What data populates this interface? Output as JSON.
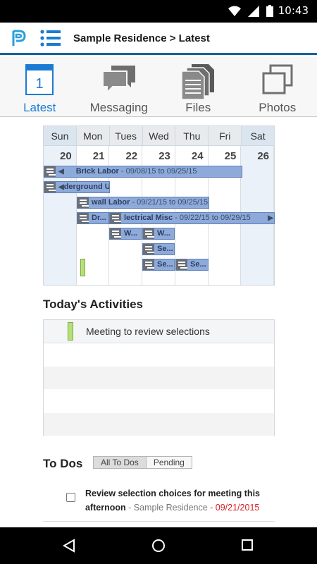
{
  "status_bar": {
    "time": "10:43"
  },
  "app_bar": {
    "title": "Sample Residence > Latest"
  },
  "tabs": [
    {
      "label": "Latest",
      "icon": "calendar-icon",
      "active": true,
      "calendar_day": "1"
    },
    {
      "label": "Messaging",
      "icon": "chat-bubbles-icon",
      "active": false
    },
    {
      "label": "Files",
      "icon": "documents-icon",
      "active": false
    },
    {
      "label": "Photos",
      "icon": "photos-icon",
      "active": false
    }
  ],
  "calendar": {
    "days": [
      "Sun",
      "Mon",
      "Tues",
      "Wed",
      "Thu",
      "Fri",
      "Sat"
    ],
    "dates": [
      "20",
      "21",
      "22",
      "23",
      "24",
      "25",
      "26"
    ],
    "events": [
      {
        "title": "Brick Labor",
        "range": " - 09/08/15 to 09/25/15"
      },
      {
        "title": "derground U..."
      },
      {
        "title": "wall Labor",
        "range": " - 09/21/15 to 09/25/15"
      },
      {
        "title": "Dr..."
      },
      {
        "title": "lectrical Misc",
        "range": " - 09/22/15 to 09/29/15"
      },
      {
        "title": "W..."
      },
      {
        "title": "W..."
      },
      {
        "title": "Se..."
      },
      {
        "title": "Se..."
      },
      {
        "title": "Se..."
      }
    ]
  },
  "activities": {
    "title": "Today's Activities",
    "items": [
      {
        "text": "Meeting to review selections"
      }
    ]
  },
  "todos": {
    "title": "To Dos",
    "filter_all": "All To Dos",
    "filter_pending": "Pending",
    "items": [
      {
        "title": "Review selection choices for meeting this afternoon",
        "project": " - Sample Residence",
        "date": " - 09/21/2015"
      }
    ]
  },
  "colors": {
    "accent": "#1a7bd4",
    "event_bar": "#8eaadb",
    "activity_marker": "#b7e07a",
    "due_date": "#d42020",
    "header_rule": "#17649a"
  }
}
